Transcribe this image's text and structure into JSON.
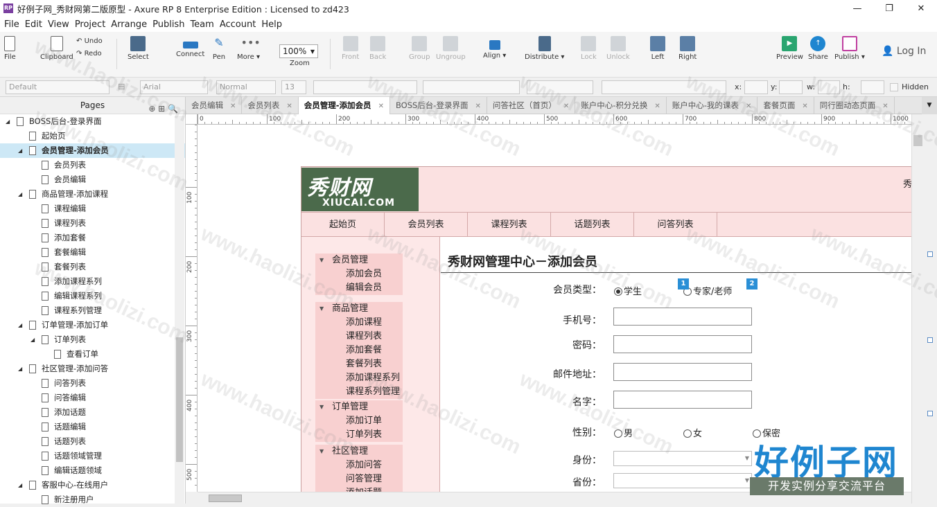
{
  "window": {
    "title": "好例子网_秀财网第二版原型 - Axure RP 8 Enterprise Edition : Licensed to zd423",
    "app_icon": "RP"
  },
  "menu": [
    "File",
    "Edit",
    "View",
    "Project",
    "Arrange",
    "Publish",
    "Team",
    "Account",
    "Help"
  ],
  "toolbar": {
    "file": "File",
    "clipboard": "Clipboard",
    "undo": "Undo",
    "redo": "Redo",
    "select": "Select",
    "connect": "Connect",
    "pen": "Pen",
    "more": "More ▾",
    "zoom_value": "100%",
    "zoom": "Zoom",
    "front": "Front",
    "back": "Back",
    "group": "Group",
    "ungroup": "Ungroup",
    "align": "Align ▾",
    "distribute": "Distribute ▾",
    "lock": "Lock",
    "unlock": "Unlock",
    "left": "Left",
    "right": "Right",
    "preview": "Preview",
    "share": "Share",
    "publish": "Publish ▾",
    "login": "Log In"
  },
  "format": {
    "style": "Default",
    "font": "Arial",
    "weight": "Normal",
    "size": "13",
    "x": "x:",
    "y": "y:",
    "w": "w:",
    "h": "h:",
    "hidden": "Hidden"
  },
  "pages_panel": {
    "title": "Pages",
    "items": [
      {
        "label": "BOSS后台-登录界面",
        "level": 0,
        "toggle": true
      },
      {
        "label": "起始页",
        "level": 1
      },
      {
        "label": "会员管理-添加会员",
        "level": 1,
        "toggle": true,
        "selected": true
      },
      {
        "label": "会员列表",
        "level": 2
      },
      {
        "label": "会员编辑",
        "level": 2
      },
      {
        "label": "商品管理-添加课程",
        "level": 1,
        "toggle": true
      },
      {
        "label": "课程编辑",
        "level": 2
      },
      {
        "label": "课程列表",
        "level": 2
      },
      {
        "label": "添加套餐",
        "level": 2
      },
      {
        "label": "套餐编辑",
        "level": 2
      },
      {
        "label": "套餐列表",
        "level": 2
      },
      {
        "label": "添加课程系列",
        "level": 2
      },
      {
        "label": "编辑课程系列",
        "level": 2
      },
      {
        "label": "课程系列管理",
        "level": 2
      },
      {
        "label": "订单管理-添加订单",
        "level": 1,
        "toggle": true
      },
      {
        "label": "订单列表",
        "level": 2,
        "toggle": true
      },
      {
        "label": "查看订单",
        "level": 3
      },
      {
        "label": "社区管理-添加问答",
        "level": 1,
        "toggle": true
      },
      {
        "label": "问答列表",
        "level": 2
      },
      {
        "label": "问答编辑",
        "level": 2
      },
      {
        "label": "添加话题",
        "level": 2
      },
      {
        "label": "话题编辑",
        "level": 2
      },
      {
        "label": "话题列表",
        "level": 2
      },
      {
        "label": "话题领域管理",
        "level": 2
      },
      {
        "label": "编辑话题领域",
        "level": 2
      },
      {
        "label": "客服中心-在线用户",
        "level": 1,
        "toggle": true
      },
      {
        "label": "新注册用户",
        "level": 2
      }
    ]
  },
  "tabs": [
    {
      "label": "会员编辑"
    },
    {
      "label": "会员列表"
    },
    {
      "label": "会员管理-添加会员",
      "active": true
    },
    {
      "label": "BOSS后台-登录界面"
    },
    {
      "label": "问答社区（首页）"
    },
    {
      "label": "账户中心-积分兑换"
    },
    {
      "label": "账户中心-我的课表"
    },
    {
      "label": "套餐页面"
    },
    {
      "label": "同行圈动态页面"
    }
  ],
  "ruler": {
    "h_ticks": [
      "0",
      "100",
      "200",
      "300",
      "400",
      "500",
      "600",
      "700",
      "800",
      "900",
      "1000"
    ],
    "v_ticks": [
      "100",
      "200",
      "300",
      "400",
      "500"
    ]
  },
  "wireframe": {
    "logo_zh": "秀财网",
    "logo_en": "XIUCAI.COM",
    "header_right": "秀",
    "nav": [
      "起始页",
      "会员列表",
      "课程列表",
      "话题列表",
      "问答列表"
    ],
    "sidebar": [
      {
        "group": "会员管理",
        "items": [
          "添加会员",
          "编辑会员"
        ]
      },
      {
        "group": "商品管理",
        "items": [
          "添加课程",
          "课程列表",
          "添加套餐",
          "套餐列表",
          "添加课程系列",
          "课程系列管理"
        ]
      },
      {
        "group": "订单管理",
        "items": [
          "添加订单",
          "订单列表"
        ]
      },
      {
        "group": "社区管理",
        "items": [
          "添加问答",
          "问答管理",
          "添加话题"
        ]
      }
    ],
    "title": "秀财网管理中心－添加会员",
    "member_type_label": "会员类型：",
    "type_student": "学生",
    "type_expert": "专家/老师",
    "badge1": "1",
    "badge2": "2",
    "phone_label": "手机号：",
    "password_label": "密码：",
    "email_label": "邮件地址：",
    "name_label": "名字：",
    "gender_label": "性别：",
    "male": "男",
    "female": "女",
    "secret": "保密",
    "identity_label": "身份：",
    "province_label": "省份："
  },
  "watermark": {
    "text": "www.haolizi.com",
    "brand": "好例子网",
    "slogan": "开发实例分享交流平台"
  }
}
